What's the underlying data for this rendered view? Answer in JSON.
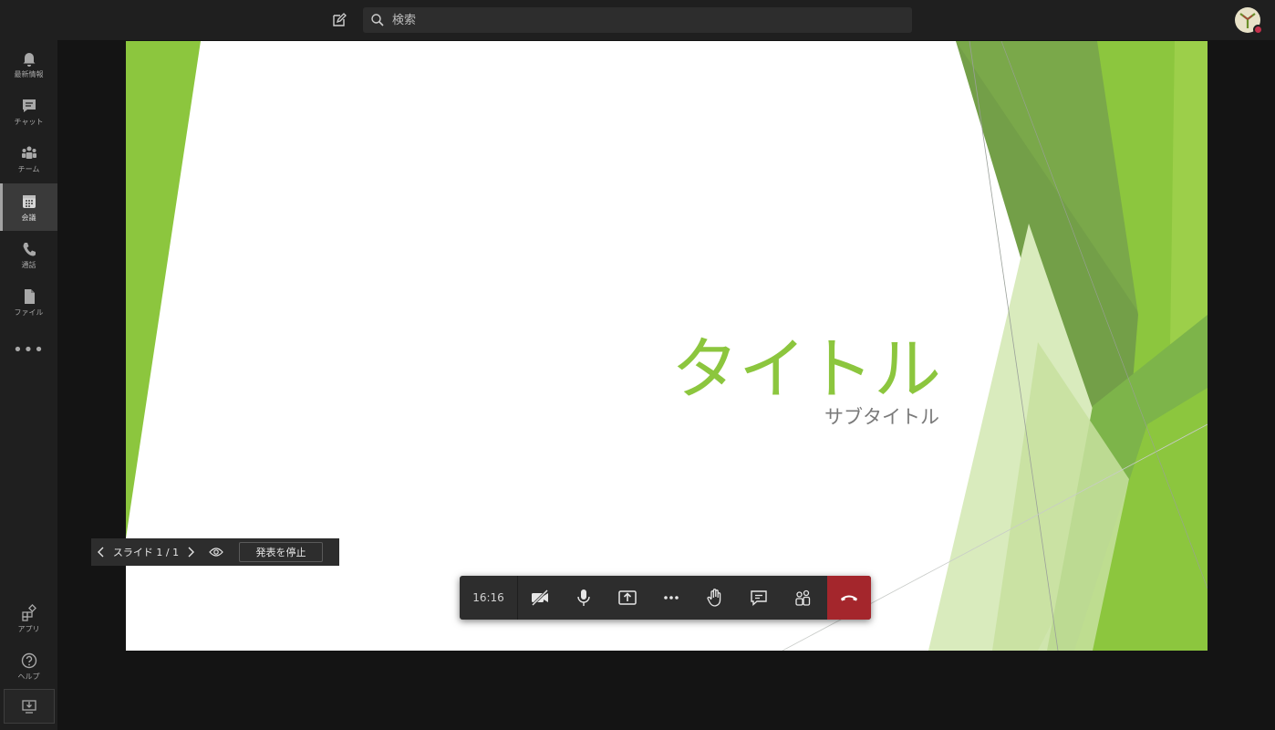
{
  "topbar": {
    "search_placeholder": "検索",
    "compose_icon": "compose-icon",
    "search_icon": "search-icon"
  },
  "rail": {
    "items": [
      {
        "label": "最新情報",
        "icon": "bell-icon"
      },
      {
        "label": "チャット",
        "icon": "chat-icon"
      },
      {
        "label": "チーム",
        "icon": "teams-icon"
      },
      {
        "label": "会議",
        "icon": "calendar-icon",
        "active": true
      },
      {
        "label": "通話",
        "icon": "phone-icon"
      },
      {
        "label": "ファイル",
        "icon": "file-icon"
      }
    ],
    "more_label": "•••",
    "bottom_items": [
      {
        "label": "アプリ",
        "icon": "apps-icon"
      },
      {
        "label": "ヘルプ",
        "icon": "help-icon"
      }
    ]
  },
  "slide": {
    "title": "タイトル",
    "subtitle": "サブタイトル"
  },
  "presenter": {
    "counter": "スライド 1 / 1",
    "stop_label": "発表を停止"
  },
  "callbar": {
    "timer": "16:16"
  },
  "colors": {
    "accent_green": "#8cc63e",
    "hangup_red": "#a4262c",
    "presence_busy": "#c4314b"
  }
}
